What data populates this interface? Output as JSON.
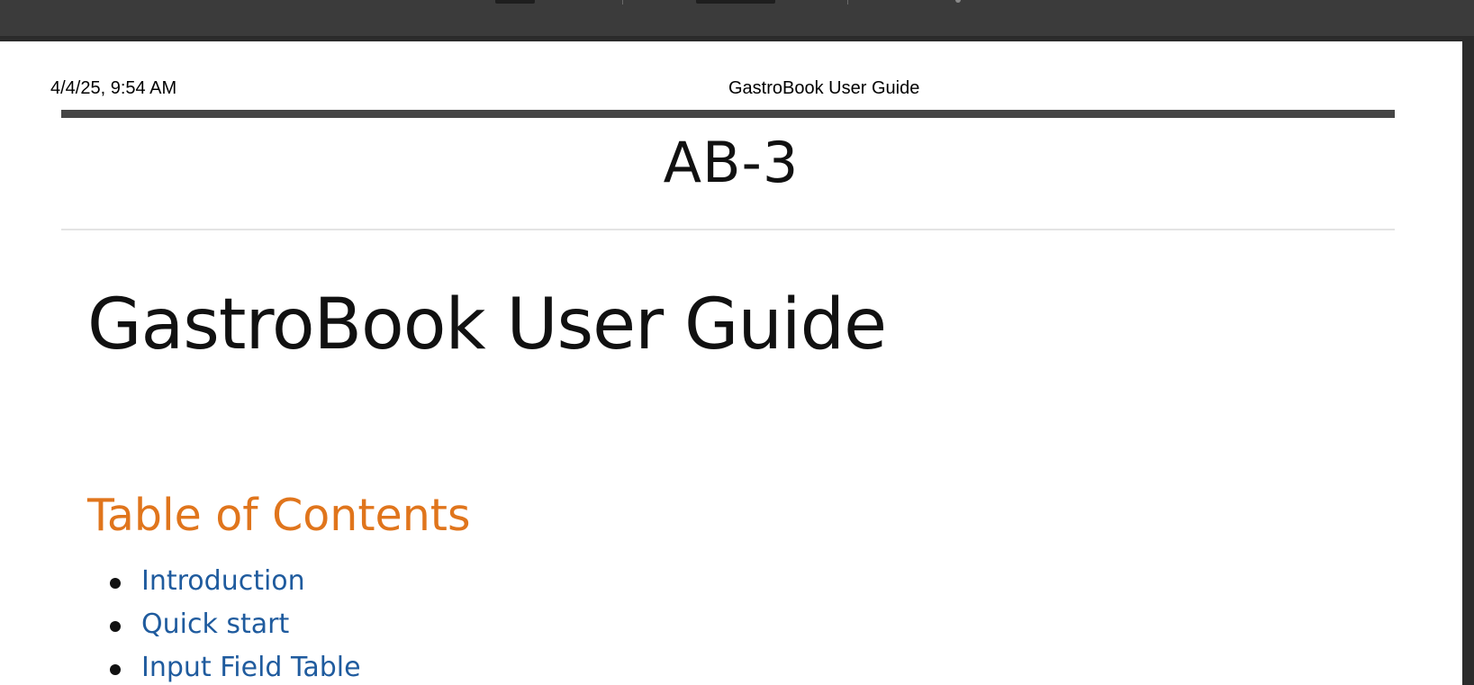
{
  "header": {
    "print_date": "4/4/25, 9:54 AM",
    "print_title": "GastroBook User Guide"
  },
  "document": {
    "code": "AB-3",
    "title": "GastroBook User Guide",
    "toc_heading": "Table of Contents",
    "toc_items": [
      {
        "label": "Introduction"
      },
      {
        "label": "Quick start"
      },
      {
        "label": "Input Field Table"
      }
    ]
  },
  "colors": {
    "toc_heading": "#e0751c",
    "link": "#1f5b9e",
    "toolbar": "#3b3b3b"
  }
}
